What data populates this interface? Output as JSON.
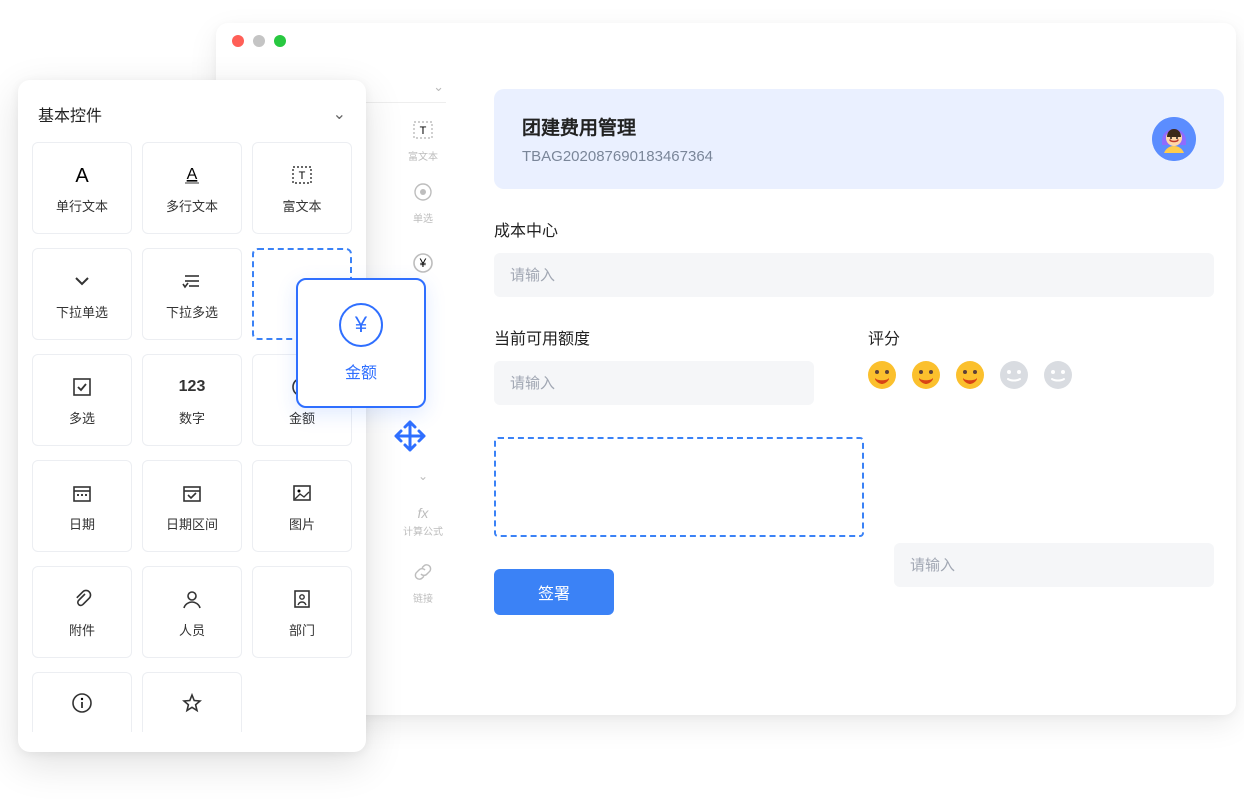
{
  "palette": {
    "title": "基本控件",
    "tiles": [
      {
        "label": "单行文本",
        "icon": "single-text"
      },
      {
        "label": "多行文本",
        "icon": "multi-text"
      },
      {
        "label": "富文本",
        "icon": "rich-text"
      },
      {
        "label": "下拉单选",
        "icon": "chevron"
      },
      {
        "label": "下拉多选",
        "icon": "multiselect"
      },
      {
        "placeholder": true
      },
      {
        "label": "多选",
        "icon": "checkbox"
      },
      {
        "label": "数字",
        "text_icon": "123"
      },
      {
        "label": "金额",
        "icon": "yen"
      },
      {
        "label": "日期",
        "icon": "date"
      },
      {
        "label": "日期区间",
        "icon": "daterange"
      },
      {
        "label": "图片",
        "icon": "image"
      },
      {
        "label": "附件",
        "icon": "attach"
      },
      {
        "label": "人员",
        "icon": "person"
      },
      {
        "label": "部门",
        "icon": "dept"
      }
    ],
    "trailing": [
      {
        "icon": "info"
      },
      {
        "icon": "star"
      }
    ]
  },
  "dragging": {
    "label": "金额"
  },
  "window": {
    "left_dropdown": "基本控件",
    "mini_rail": [
      {
        "label": "富文本",
        "icon": "rich-text"
      },
      {
        "label": "单选",
        "icon": "radio"
      },
      {
        "label": "",
        "icon": "yen"
      },
      {
        "collapse": true
      },
      {
        "label": "计算公式",
        "text_icon": "fx"
      },
      {
        "label": "链接",
        "icon": "link"
      }
    ]
  },
  "preview": {
    "title": "团建费用管理",
    "code": "TBAG202087690183467364",
    "fields": {
      "cost_center_label": "成本中心",
      "cost_center_ph": "请输入",
      "quota_label": "当前可用额度",
      "quota_ph": "请输入",
      "rating_label": "评分",
      "right_input_ph": "请输入"
    },
    "rating_value": 3,
    "rating_max": 5,
    "submit_label": "签署"
  },
  "colors": {
    "primary": "#3b82f6",
    "accent": "#2f6fff",
    "banner_bg": "#eaf0ff"
  }
}
